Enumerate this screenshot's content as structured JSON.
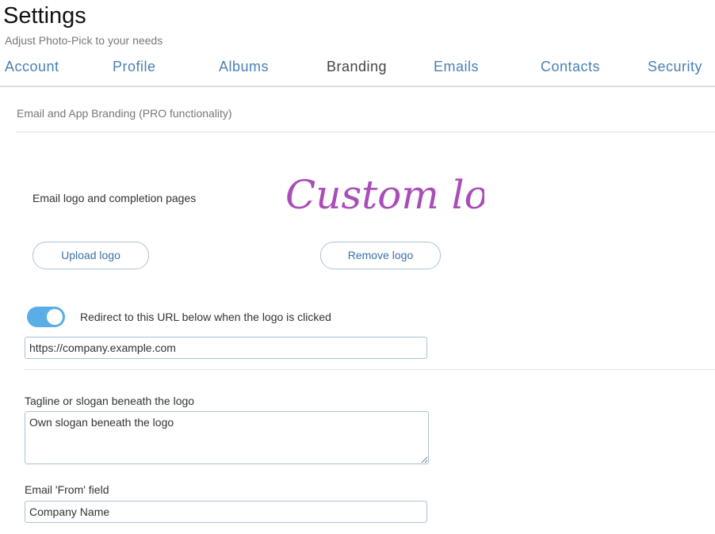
{
  "header": {
    "title": "Settings",
    "subtitle": "Adjust Photo-Pick to your needs"
  },
  "tabs": [
    {
      "label": "Account",
      "active": false
    },
    {
      "label": "Profile",
      "active": false
    },
    {
      "label": "Albums",
      "active": false
    },
    {
      "label": "Branding",
      "active": true
    },
    {
      "label": "Emails",
      "active": false
    },
    {
      "label": "Contacts",
      "active": false
    },
    {
      "label": "Security",
      "active": false
    }
  ],
  "branding": {
    "section_title": "Email and App Branding (PRO functionality)",
    "logo_label": "Email logo and completion pages",
    "logo_text": "Custom logo",
    "upload_button": "Upload logo",
    "remove_button": "Remove logo",
    "redirect_toggle": {
      "label": "Redirect to this URL below when the logo is clicked",
      "on": true
    },
    "redirect_url": "https://company.example.com",
    "tagline_label": "Tagline or slogan beneath the logo",
    "tagline_value": "Own slogan beneath the logo",
    "from_label": "Email 'From' field",
    "from_value": "Company Name"
  },
  "colors": {
    "accent": "#4a7fb5",
    "toggle_on": "#5aaee6",
    "logo_purple": "#a94db8"
  }
}
